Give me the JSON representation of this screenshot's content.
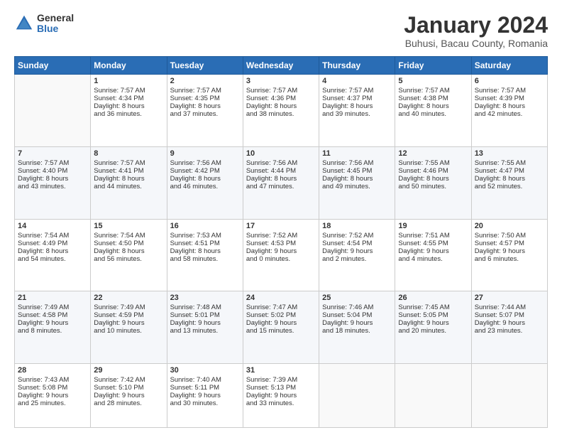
{
  "logo": {
    "general": "General",
    "blue": "Blue"
  },
  "header": {
    "title": "January 2024",
    "subtitle": "Buhusi, Bacau County, Romania"
  },
  "days": [
    "Sunday",
    "Monday",
    "Tuesday",
    "Wednesday",
    "Thursday",
    "Friday",
    "Saturday"
  ],
  "weeks": [
    [
      {
        "num": "",
        "lines": []
      },
      {
        "num": "1",
        "lines": [
          "Sunrise: 7:57 AM",
          "Sunset: 4:34 PM",
          "Daylight: 8 hours",
          "and 36 minutes."
        ]
      },
      {
        "num": "2",
        "lines": [
          "Sunrise: 7:57 AM",
          "Sunset: 4:35 PM",
          "Daylight: 8 hours",
          "and 37 minutes."
        ]
      },
      {
        "num": "3",
        "lines": [
          "Sunrise: 7:57 AM",
          "Sunset: 4:36 PM",
          "Daylight: 8 hours",
          "and 38 minutes."
        ]
      },
      {
        "num": "4",
        "lines": [
          "Sunrise: 7:57 AM",
          "Sunset: 4:37 PM",
          "Daylight: 8 hours",
          "and 39 minutes."
        ]
      },
      {
        "num": "5",
        "lines": [
          "Sunrise: 7:57 AM",
          "Sunset: 4:38 PM",
          "Daylight: 8 hours",
          "and 40 minutes."
        ]
      },
      {
        "num": "6",
        "lines": [
          "Sunrise: 7:57 AM",
          "Sunset: 4:39 PM",
          "Daylight: 8 hours",
          "and 42 minutes."
        ]
      }
    ],
    [
      {
        "num": "7",
        "lines": [
          "Sunrise: 7:57 AM",
          "Sunset: 4:40 PM",
          "Daylight: 8 hours",
          "and 43 minutes."
        ]
      },
      {
        "num": "8",
        "lines": [
          "Sunrise: 7:57 AM",
          "Sunset: 4:41 PM",
          "Daylight: 8 hours",
          "and 44 minutes."
        ]
      },
      {
        "num": "9",
        "lines": [
          "Sunrise: 7:56 AM",
          "Sunset: 4:42 PM",
          "Daylight: 8 hours",
          "and 46 minutes."
        ]
      },
      {
        "num": "10",
        "lines": [
          "Sunrise: 7:56 AM",
          "Sunset: 4:44 PM",
          "Daylight: 8 hours",
          "and 47 minutes."
        ]
      },
      {
        "num": "11",
        "lines": [
          "Sunrise: 7:56 AM",
          "Sunset: 4:45 PM",
          "Daylight: 8 hours",
          "and 49 minutes."
        ]
      },
      {
        "num": "12",
        "lines": [
          "Sunrise: 7:55 AM",
          "Sunset: 4:46 PM",
          "Daylight: 8 hours",
          "and 50 minutes."
        ]
      },
      {
        "num": "13",
        "lines": [
          "Sunrise: 7:55 AM",
          "Sunset: 4:47 PM",
          "Daylight: 8 hours",
          "and 52 minutes."
        ]
      }
    ],
    [
      {
        "num": "14",
        "lines": [
          "Sunrise: 7:54 AM",
          "Sunset: 4:49 PM",
          "Daylight: 8 hours",
          "and 54 minutes."
        ]
      },
      {
        "num": "15",
        "lines": [
          "Sunrise: 7:54 AM",
          "Sunset: 4:50 PM",
          "Daylight: 8 hours",
          "and 56 minutes."
        ]
      },
      {
        "num": "16",
        "lines": [
          "Sunrise: 7:53 AM",
          "Sunset: 4:51 PM",
          "Daylight: 8 hours",
          "and 58 minutes."
        ]
      },
      {
        "num": "17",
        "lines": [
          "Sunrise: 7:52 AM",
          "Sunset: 4:53 PM",
          "Daylight: 9 hours",
          "and 0 minutes."
        ]
      },
      {
        "num": "18",
        "lines": [
          "Sunrise: 7:52 AM",
          "Sunset: 4:54 PM",
          "Daylight: 9 hours",
          "and 2 minutes."
        ]
      },
      {
        "num": "19",
        "lines": [
          "Sunrise: 7:51 AM",
          "Sunset: 4:55 PM",
          "Daylight: 9 hours",
          "and 4 minutes."
        ]
      },
      {
        "num": "20",
        "lines": [
          "Sunrise: 7:50 AM",
          "Sunset: 4:57 PM",
          "Daylight: 9 hours",
          "and 6 minutes."
        ]
      }
    ],
    [
      {
        "num": "21",
        "lines": [
          "Sunrise: 7:49 AM",
          "Sunset: 4:58 PM",
          "Daylight: 9 hours",
          "and 8 minutes."
        ]
      },
      {
        "num": "22",
        "lines": [
          "Sunrise: 7:49 AM",
          "Sunset: 4:59 PM",
          "Daylight: 9 hours",
          "and 10 minutes."
        ]
      },
      {
        "num": "23",
        "lines": [
          "Sunrise: 7:48 AM",
          "Sunset: 5:01 PM",
          "Daylight: 9 hours",
          "and 13 minutes."
        ]
      },
      {
        "num": "24",
        "lines": [
          "Sunrise: 7:47 AM",
          "Sunset: 5:02 PM",
          "Daylight: 9 hours",
          "and 15 minutes."
        ]
      },
      {
        "num": "25",
        "lines": [
          "Sunrise: 7:46 AM",
          "Sunset: 5:04 PM",
          "Daylight: 9 hours",
          "and 18 minutes."
        ]
      },
      {
        "num": "26",
        "lines": [
          "Sunrise: 7:45 AM",
          "Sunset: 5:05 PM",
          "Daylight: 9 hours",
          "and 20 minutes."
        ]
      },
      {
        "num": "27",
        "lines": [
          "Sunrise: 7:44 AM",
          "Sunset: 5:07 PM",
          "Daylight: 9 hours",
          "and 23 minutes."
        ]
      }
    ],
    [
      {
        "num": "28",
        "lines": [
          "Sunrise: 7:43 AM",
          "Sunset: 5:08 PM",
          "Daylight: 9 hours",
          "and 25 minutes."
        ]
      },
      {
        "num": "29",
        "lines": [
          "Sunrise: 7:42 AM",
          "Sunset: 5:10 PM",
          "Daylight: 9 hours",
          "and 28 minutes."
        ]
      },
      {
        "num": "30",
        "lines": [
          "Sunrise: 7:40 AM",
          "Sunset: 5:11 PM",
          "Daylight: 9 hours",
          "and 30 minutes."
        ]
      },
      {
        "num": "31",
        "lines": [
          "Sunrise: 7:39 AM",
          "Sunset: 5:13 PM",
          "Daylight: 9 hours",
          "and 33 minutes."
        ]
      },
      {
        "num": "",
        "lines": []
      },
      {
        "num": "",
        "lines": []
      },
      {
        "num": "",
        "lines": []
      }
    ]
  ]
}
